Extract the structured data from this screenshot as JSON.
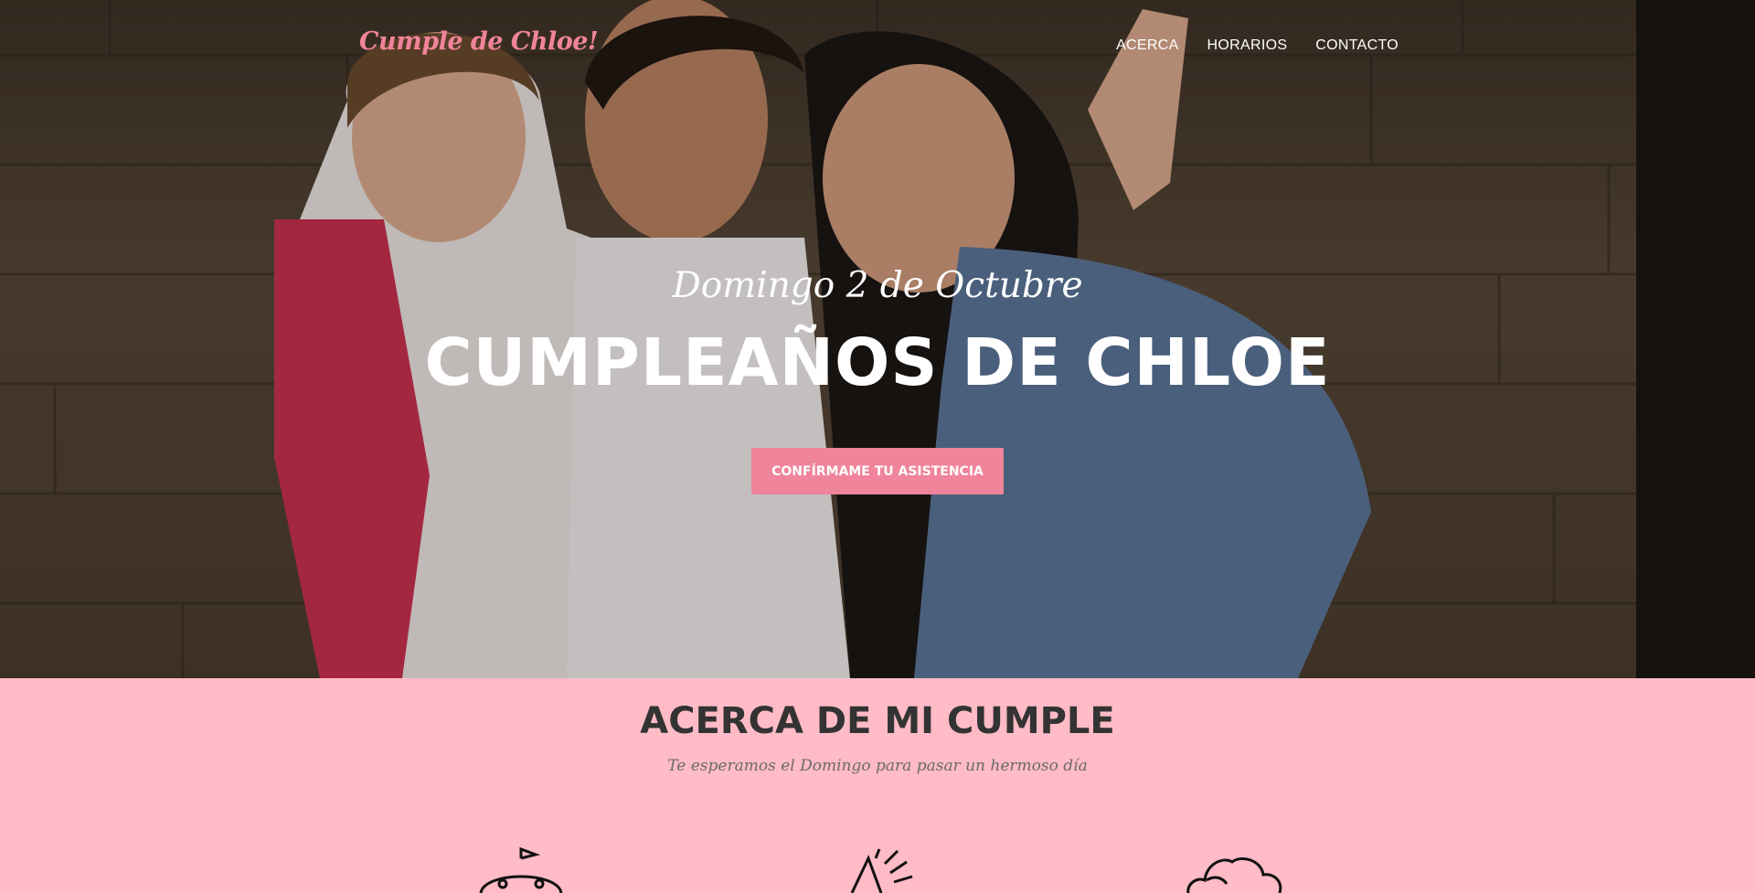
{
  "navbar": {
    "brand": "Cumple de Chloe!",
    "links": [
      "ACERCA",
      "HORARIOS",
      "CONTACTO"
    ]
  },
  "hero": {
    "subtitle": "Domingo 2 de Octubre",
    "title": "CUMPLEAÑOS DE CHLOE",
    "cta_label": "CONFÍRMAME TU ASISTENCIA"
  },
  "about": {
    "heading": "ACERCA DE MI CUMPLE",
    "subheading": "Te esperamos el Domingo para pasar un hermoso día",
    "feature_icons": [
      "toy-icon",
      "party-popper-icon",
      "cupcake-icon"
    ]
  },
  "colors": {
    "brand_pink": "#F0849A",
    "section_pink": "#FFBBC6",
    "heading_dark": "#333333",
    "text_white": "#FFFFFF"
  }
}
